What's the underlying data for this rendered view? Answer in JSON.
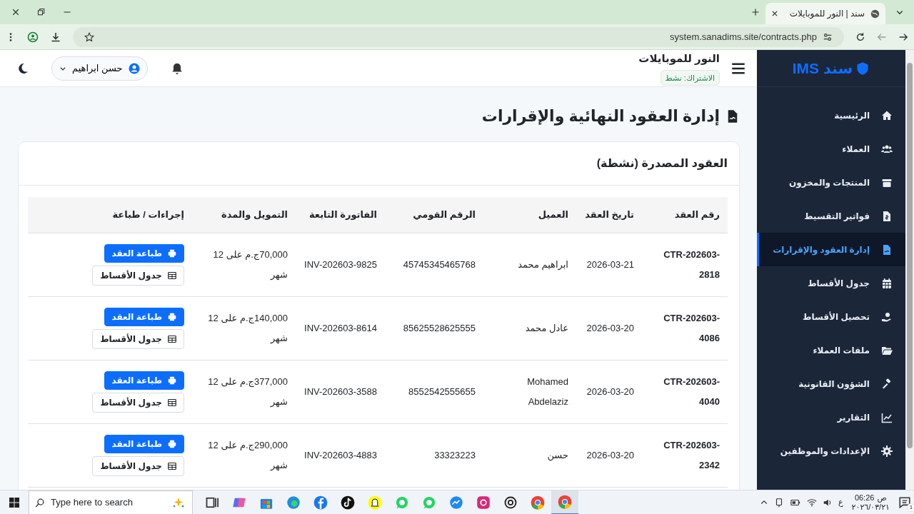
{
  "browser": {
    "tab_title": "سند | النور للموبايلات",
    "url": "system.sanadims.site/contracts.php"
  },
  "sidebar": {
    "logo": "سند IMS",
    "items": [
      {
        "label": "الرئيسية",
        "selected": false
      },
      {
        "label": "العملاء",
        "selected": false
      },
      {
        "label": "المنتجات والمخزون",
        "selected": false
      },
      {
        "label": "فواتير التقسيط",
        "selected": false
      },
      {
        "label": "إدارة العقود والإقرارات",
        "selected": true
      },
      {
        "label": "جدول الأقساط",
        "selected": false
      },
      {
        "label": "تحصيل الأقساط",
        "selected": false
      },
      {
        "label": "ملفات العملاء",
        "selected": false
      },
      {
        "label": "الشؤون القانونية",
        "selected": false
      },
      {
        "label": "التقارير",
        "selected": false
      },
      {
        "label": "الإعدادات والموظفين",
        "selected": false
      }
    ]
  },
  "header": {
    "store_name": "النور للموبايلات",
    "subscription": "الاشتراك: نشط",
    "user": "حسن ابراهيم"
  },
  "page_title": "إدارة العقود النهائية والإقرارات",
  "card": {
    "title": "العقود المصدرة (نشطة)",
    "columns": [
      "رقم العقد",
      "تاريخ العقد",
      "العميل",
      "الرقم القومي",
      "الفاتورة التابعة",
      "التمويل والمدة",
      "إجراءات / طباعة"
    ],
    "rows": [
      {
        "contract": "CTR-202603-2818",
        "date": "2026-03-21",
        "client": "ابراهيم محمد",
        "national_id": "45745345465768",
        "invoice": "INV-202603-9825",
        "financing": "70,000ج.م على 12 شهر",
        "actions": [
          "طباعة العقد",
          "جدول الأقساط"
        ]
      },
      {
        "contract": "CTR-202603-4086",
        "date": "2026-03-20",
        "client": "عادل محمد",
        "national_id": "85625528625555",
        "invoice": "INV-202603-8614",
        "financing": "140,000ج.م على 12 شهر",
        "actions": [
          "طباعة العقد",
          "جدول الأقساط"
        ]
      },
      {
        "contract": "CTR-202603-4040",
        "date": "2026-03-20",
        "client": "Mohamed Abdelaziz",
        "national_id": "8552542555655",
        "invoice": "INV-202603-3588",
        "financing": "377,000ج.م على 12 شهر",
        "actions": [
          "طباعة العقد",
          "جدول الأقساط"
        ]
      },
      {
        "contract": "CTR-202603-2342",
        "date": "2026-03-20",
        "client": "حسن",
        "national_id": "33323223",
        "invoice": "INV-202603-4883",
        "financing": "290,000ج.م على 12 شهر",
        "actions": [
          "طباعة العقد",
          "جدول الأقساط"
        ]
      }
    ]
  },
  "taskbar": {
    "search_placeholder": "Type here to search",
    "period": "ص",
    "time": "06:26",
    "date": "٢٠٢٦/٠٣/٢١",
    "language": "ع",
    "notifications": "1"
  }
}
